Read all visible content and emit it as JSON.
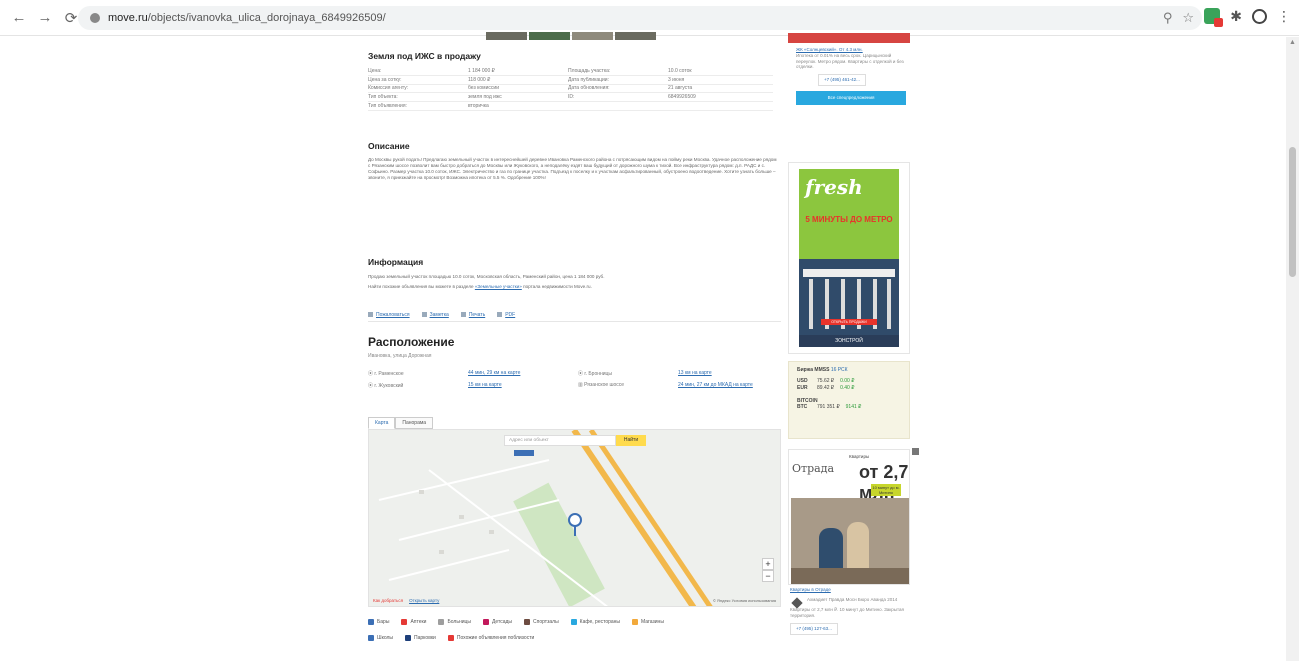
{
  "browser": {
    "url_host": "move.ru",
    "url_path": "/objects/ivanovka_ulica_dorojnaya_6849926509/"
  },
  "listing": {
    "title": "Земля под ИЖС в продажу",
    "rows": [
      [
        "Цена:",
        "1 184 000 ₽",
        "Площадь участка:",
        "10.0 соток"
      ],
      [
        "Цена за сотку:",
        "118 000 ₽",
        "Дата публикации:",
        "3 июня"
      ],
      [
        "Комиссия агенту:",
        "без комиссии",
        "Дата обновления:",
        "21 августа"
      ],
      [
        "Тип объекта:",
        "земля под ижс",
        "ID:",
        "6849926509"
      ],
      [
        "Тип объявления:",
        "вторичка",
        "",
        ""
      ]
    ]
  },
  "description": {
    "title": "Описание",
    "text": "До Москвы рукой подать! Предлагаю земельный участок в интереснейшей деревне Ивановка Раменского района с потрясающим видом на пойму реки Москва. Удачное расположение рядом с Рязанским шоссе позволит вам быстро добраться до Москвы или Жуковского, а неподалёку ездят ваш будущий от дорожного шума к тихой. Все инфраструктура рядом: д.п. РАДС и с. Софьино. Размер участка 10.0 соток, ИЖС. Электричество и газ по границе участка. Подъезд к поселку и к участкам асфальтированный, обустроено водоотведение. Хотите узнать больше – звоните, я приезжайте на просмотр! Возможна ипотека от 5.5 %. Одобрение 100%!"
  },
  "information": {
    "title": "Информация",
    "line1": "Продаю земельный участок площадью 10.0 соток, Московская область, Раменский район, цена 1 184 000 руб.",
    "line2_prefix": "Найти похожие объявления вы можете в разделе",
    "line2_link": "«Земельные участки»",
    "line2_suffix": "портала недвижимости Move.ru."
  },
  "actions": [
    "Пожаловаться",
    "Заметка",
    "Печать",
    "PDF"
  ],
  "location": {
    "title": "Расположение",
    "address": "Ивановка, улица Дорожная",
    "metro": [
      [
        "⦿ г. Раменское",
        "44 мин, 29 км на карте",
        "⦿ г. Бронницы",
        "13 км на карте"
      ],
      [
        "⦿ г. Жуковский",
        "15 км на карте",
        "▥ Рязанское шоссе",
        "24 мин, 27 км до МКАД на карте"
      ]
    ]
  },
  "map": {
    "tabs": [
      "Карта",
      "Панорама"
    ],
    "search_placeholder": "Адрес или объект",
    "find_button": "Найти",
    "zoom_in": "+",
    "zoom_out": "−",
    "route_label": "Как добраться",
    "open_large": "Открыть карту",
    "copyright": "© Яндекс Условия использования"
  },
  "poi": {
    "row1": [
      "Бары",
      "Аптеки",
      "Больницы",
      "Детсады",
      "Спортзалы",
      "Кафе, рестораны",
      "Магазины"
    ],
    "row2": [
      "Школы",
      "Парковки",
      "Похожие объявления поблизости"
    ]
  },
  "sidebar": {
    "ad1_title": "ЖК «Солнцевский». От 4.3 млн.",
    "ad1_text": "Ипотека от 0.01% на весь срок. Царицынский переулок. Метро рядом. Квартиры с отделкой и без отделки.",
    "ad1_phone": "+7 (495) 461-42...",
    "ad1_button": "Все спецпредложения",
    "fresh_logo": "fresh",
    "fresh_slogan": "5 МИНУТЫ ДО МЕТРО",
    "fresh_bar": "ОТКРЫТЬ ПРОДАЖИ",
    "fresh_bottom": "ЗОНСТРОЙ",
    "exchange_title": "Биржа MMSS",
    "exchange_updated": "16 РСК",
    "exchange": [
      [
        "USD",
        "75.62 ₽",
        "0.00 ₽"
      ],
      [
        "EUR",
        "89.42 ₽",
        "0.40 ₽"
      ]
    ],
    "bitcoin_label": "BITCOIN",
    "bitcoin": [
      "BTC",
      "791 351 ₽",
      "9141 ₽"
    ],
    "otrada_logo": "Отрада",
    "otrada_price_label": "Квартиры",
    "otrada_price": "от 2,7 млн",
    "otrada_badge": "10 минут до м. Митино",
    "ad2_title": "Квартиры в Отраде",
    "ad2_brand": "Ахмадиет Правда Мосн Бюро Аванда 2014",
    "ad2_text": "Квартиры от 2,7 млн ₽. 10 минут до Митино. Закрытая территория.",
    "ad2_phone": "+7 (495) 127-63..."
  }
}
